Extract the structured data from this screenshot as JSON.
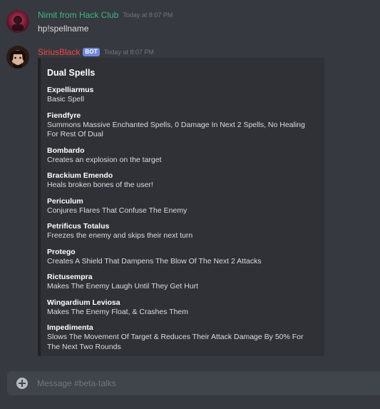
{
  "messages": [
    {
      "author": "Nimit from Hack Club",
      "author_color": "#43b581",
      "timestamp": "Today at 8:07 PM",
      "text": "hp!spellname"
    },
    {
      "author": "SiriusBlack",
      "author_color": "#f04747",
      "bot_tag": "BOT",
      "timestamp": "Today at 8:07 PM",
      "embed": {
        "title": "Dual Spells",
        "fields": [
          {
            "name": "Expelliarmus",
            "value": "Basic Spell"
          },
          {
            "name": "Fiendfyre",
            "value": "Summons Massive Enchanted Spells, 0 Damage In Next 2 Spells, No Healing For Rest Of Dual"
          },
          {
            "name": "Bombardo",
            "value": "Creates an explosion on the target"
          },
          {
            "name": "Brackium Emendo",
            "value": "Heals broken bones of the user!"
          },
          {
            "name": "Periculum",
            "value": "Conjures Flares That Confuse The Enemy"
          },
          {
            "name": "Petrificus Totalus",
            "value": "Freezes the enemy and skips their next turn"
          },
          {
            "name": "Protego",
            "value": "Creates A Shield That Dampens The Blow Of The Next 2 Attacks"
          },
          {
            "name": "Rictusempra",
            "value": "Makes The Enemy Laugh Until They Get Hurt"
          },
          {
            "name": "Wingardium Leviosa",
            "value": "Makes The Enemy Float, & Crashes Them"
          },
          {
            "name": "Impedimenta",
            "value": "Slows The Movement Of Target & Reduces Their Attack Damage By 50% For The Next Two Rounds"
          }
        ]
      }
    }
  ],
  "composer": {
    "placeholder": "Message #beta-talks",
    "value": ""
  },
  "icons": {
    "attach": "plus-circle-icon"
  },
  "colors": {
    "background": "#36393f",
    "embed_background": "#2f3136",
    "embed_border": "#202225",
    "bot_tag": "#7289da",
    "input_background": "#40444b"
  }
}
